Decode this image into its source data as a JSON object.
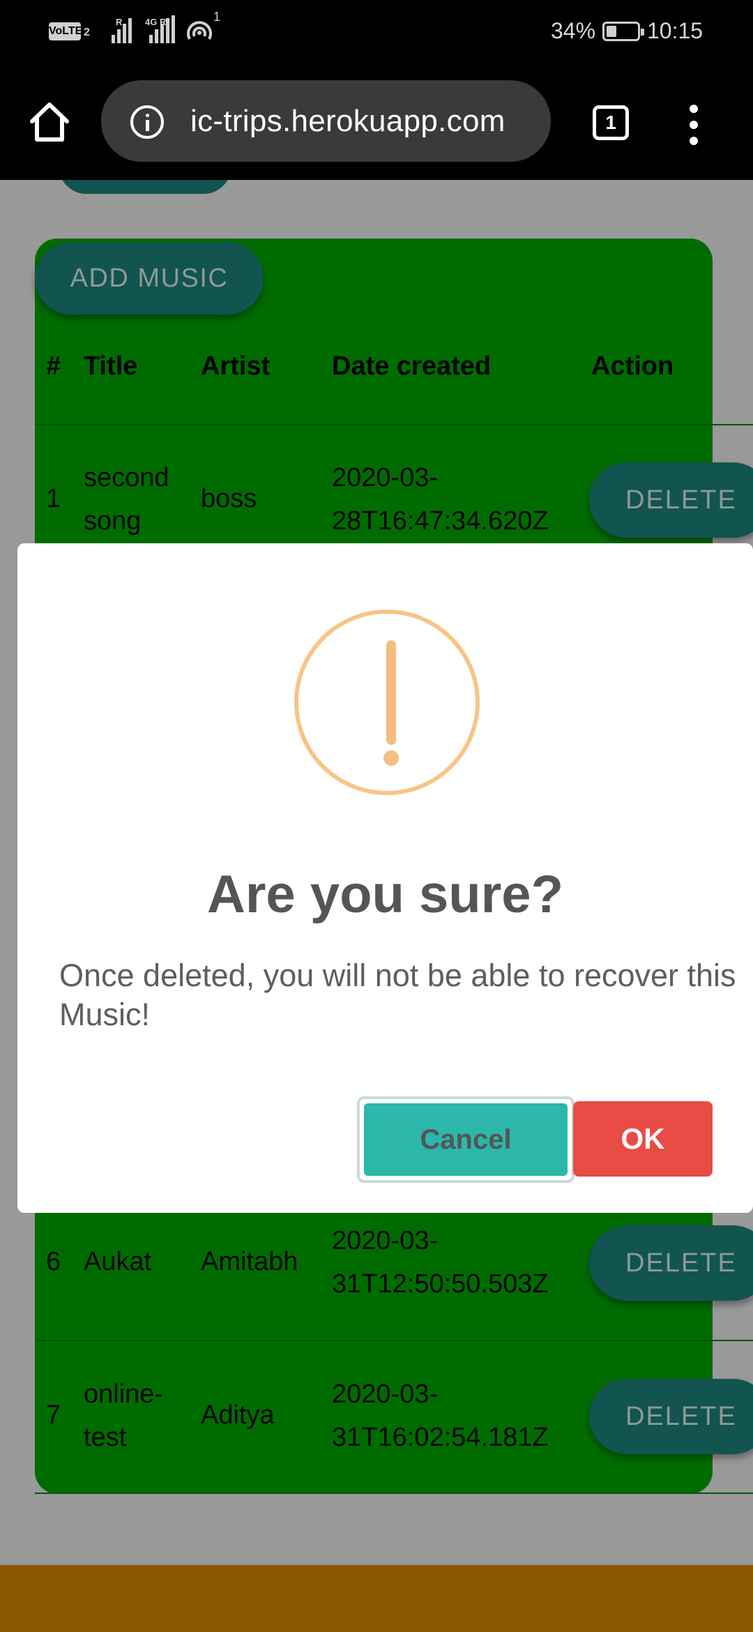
{
  "status_bar": {
    "volte_label": "VoLTE",
    "sim_number": "2",
    "network_tag_1": "R",
    "network_tag_2": "4G R",
    "hotspot_superscript": "1",
    "battery_percent": "34%",
    "battery_level": 0.34,
    "time": "10:15"
  },
  "browser": {
    "url": "ic-trips.herokuapp.com",
    "tab_count": "1"
  },
  "page": {
    "add_button_label": "ADD MUSIC",
    "table": {
      "columns": [
        "#",
        "Title",
        "Artist",
        "Date created",
        "Action"
      ],
      "rows": [
        {
          "num": "1",
          "title_line1": "second",
          "title_line2": "song",
          "artist": "boss",
          "date_line1": "2020-03-",
          "date_line2": "28T16:47:34.620Z",
          "action": "DELETE"
        },
        {
          "num": "6",
          "title_line1": "Aukat",
          "title_line2": "",
          "artist": "Amitabh",
          "date_line1": "2020-03-",
          "date_line2": "31T12:50:50.503Z",
          "action": "DELETE"
        },
        {
          "num": "7",
          "title_line1": "online-",
          "title_line2": "test",
          "artist": "Aditya",
          "date_line1": "2020-03-",
          "date_line2": "31T16:02:54.181Z",
          "action": "DELETE"
        }
      ]
    }
  },
  "modal": {
    "icon": "warning-exclamation-icon",
    "title": "Are you sure?",
    "text": "Once deleted, you will not be able to recover this Music!",
    "cancel_label": "Cancel",
    "ok_label": "OK"
  },
  "colors": {
    "card_green": "#00b400",
    "button_teal": "#1f8c84",
    "cancel_teal": "#2bb8ab",
    "ok_red": "#e84c44",
    "warning_orange": "#f8c486",
    "footer_orange": "#e59400"
  }
}
